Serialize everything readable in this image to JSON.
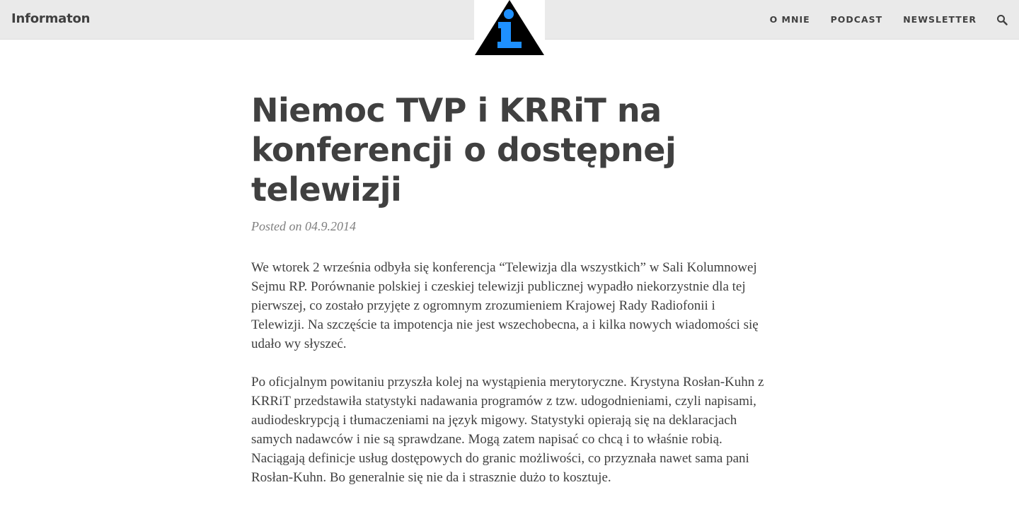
{
  "site": {
    "brand": "Informaton",
    "logo": "info-triangle-logo"
  },
  "nav": {
    "items": [
      {
        "label": "O MNIE"
      },
      {
        "label": "PODCAST"
      },
      {
        "label": "NEWSLETTER"
      }
    ],
    "search_icon": "search-icon"
  },
  "post": {
    "title": "Niemoc TVP i KRRiT na konferencji o dostępnej telewizji",
    "meta": "Posted on 04.9.2014",
    "paragraphs": [
      "We wtorek 2 września odbyła się konferencja “Telewizja dla wszystkich” w Sali Kolumnowej Sejmu RP. Porównanie polskiej i czeskiej telewizji publicznej wypadło niekorzystnie dla tej pierwszej, co zostało przyjęte z ogromnym zrozumieniem Krajowej Rady Radiofonii i Telewizji. Na szczęście ta impotencja nie jest wszechobecna, a i kilka nowych wiadomości się udało wy słyszeć.",
      "Po oficjalnym powitaniu przyszła kolej na wystąpienia merytoryczne. Krystyna Rosłan-Kuhn z KRRiT przedstawiła statystyki nadawania programów z tzw. udogodnieniami, czyli napisami, audiodeskrypcją i tłumaczeniami na język migowy. Statystyki opierają się na deklaracjach samych nadawców i nie są sprawdzane. Mogą zatem napisać co chcą i to właśnie robią. Naciągają definicje usług dostępowych do granic możliwości, co przyznała nawet sama pani Rosłan-Kuhn. Bo generalnie się nie da i strasznie dużo to kosztuje."
    ]
  },
  "colors": {
    "navbar_bg": "#eaeaea",
    "text": "#404040",
    "meta": "#808080",
    "logo_blue": "#1e90ff",
    "logo_black": "#000000"
  }
}
